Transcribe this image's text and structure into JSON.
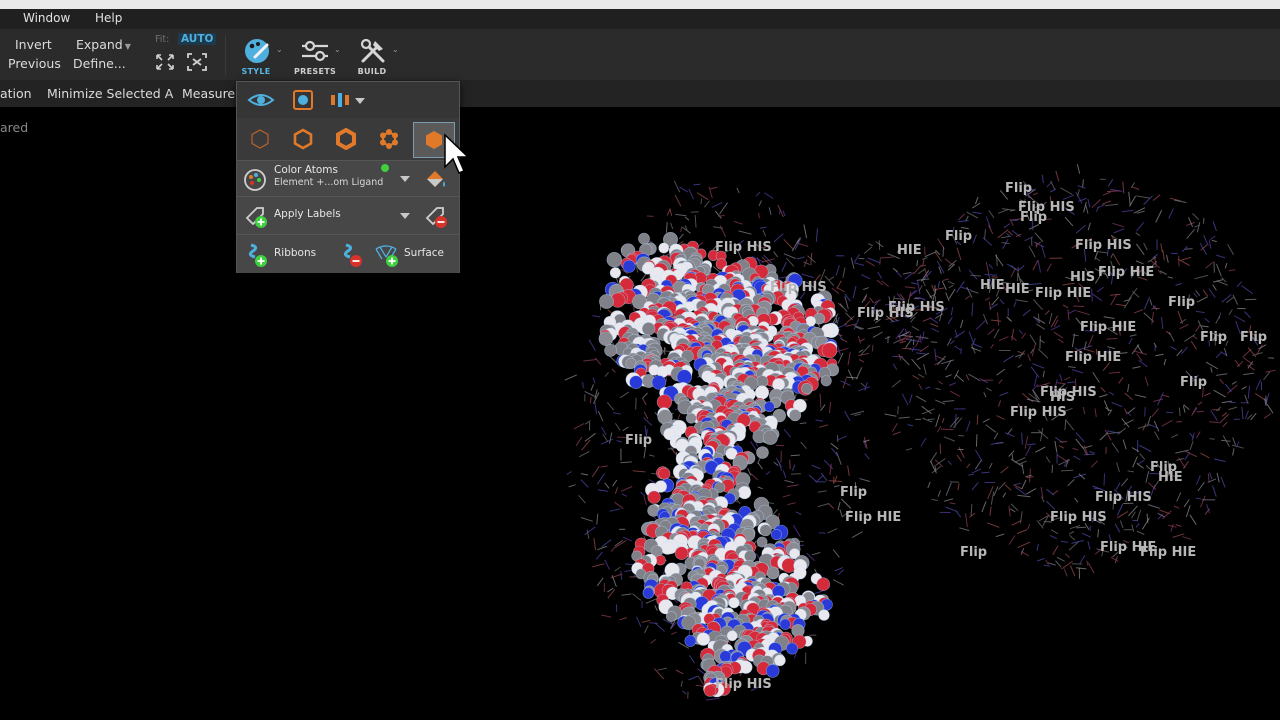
{
  "menubar": {
    "items": [
      "Window",
      "Help"
    ]
  },
  "toolbar": {
    "invert": "Invert",
    "previous": "Previous",
    "expand": "Expand",
    "define": "Define...",
    "fit_label": "Fit:",
    "fit_mode": "AUTO",
    "style_label": "STYLE",
    "presets_label": "PRESETS",
    "build_label": "BUILD"
  },
  "toolbar2": {
    "items": [
      "ation",
      "Minimize Selected A",
      "Measure"
    ]
  },
  "side_text": "ared",
  "style_popup": {
    "color_atoms_title": "Color Atoms",
    "color_atoms_scheme": "Element +...om Ligand",
    "apply_labels": "Apply Labels",
    "ribbons": "Ribbons",
    "surface": "Surface"
  },
  "colors": {
    "accent": "#4fb0df",
    "orange": "#e07a2a",
    "green": "#3fcf3f",
    "red": "#d9322a"
  },
  "icons": [
    "eye-icon",
    "camera-icon",
    "alignment-icon",
    "wire-icon",
    "line-icon",
    "ball-stick-icon",
    "ballstick-icon",
    "cpk-icon",
    "palette-icon",
    "paint-bucket-icon",
    "label-add-icon",
    "label-remove-icon",
    "ribbon-add-icon",
    "ribbon-remove-icon",
    "surface-add-icon"
  ],
  "molecule_labels": [
    "Flip HIS",
    "Flip HIS",
    "Flip HIE",
    "Flip HIS",
    "Flip HIE",
    "Flip HIS",
    "Flip HIS",
    "HIE",
    "Flip",
    "HIE",
    "Flip HIE",
    "Flip HIS",
    "Flip HIS",
    "Flip",
    "Flip HIE",
    "Flip",
    "Flip",
    "Flip HIE",
    "Flip HIS",
    "HIE",
    "HIS",
    "Flip",
    "Flip HIS",
    "Flip",
    "Flip",
    "Flip HIS",
    "Flip HIE",
    "Flip HIS",
    "Flip",
    "Flip HIE",
    "Flip",
    "HIS",
    "HIE",
    "Flip",
    "Flip"
  ]
}
